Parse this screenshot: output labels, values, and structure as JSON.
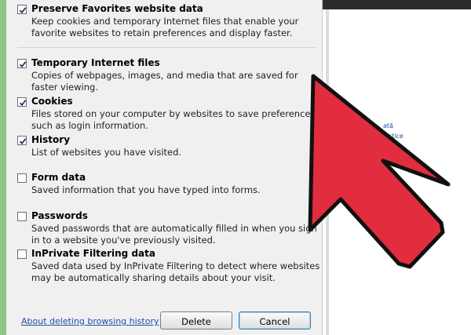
{
  "options": [
    {
      "title": "Preserve Favorites website data",
      "checked": true,
      "description": "Keep cookies and temporary Internet files that enable your favorite websites to retain preferences and display faster."
    },
    {
      "title": "Temporary Internet files",
      "checked": true,
      "description": "Copies of webpages, images, and media that are saved for faster viewing."
    },
    {
      "title": "Cookies",
      "checked": true,
      "description": "Files stored on your computer by websites to save preferences such as login information."
    },
    {
      "title": "History",
      "checked": true,
      "description": "List of websites you have visited."
    },
    {
      "title": "Form data",
      "checked": false,
      "description": "Saved information that you have typed into forms."
    },
    {
      "title": "Passwords",
      "checked": false,
      "description": "Saved passwords that are automatically filled in when you sign in to a website you've previously visited."
    },
    {
      "title": "InPrivate Filtering data",
      "checked": false,
      "description": "Saved data used by InPrivate Filtering to detect where websites may be automatically sharing details about your visit."
    }
  ],
  "footer": {
    "about_link": "About deleting browsing history",
    "delete_label": "Delete",
    "cancel_label": "Cancel"
  },
  "background": {
    "link_1": "ată",
    "link_2": "vistice"
  },
  "colors": {
    "arrow_fill": "#e12d3e",
    "arrow_outline": "#111111",
    "check_mark": "#1a3a6b"
  }
}
